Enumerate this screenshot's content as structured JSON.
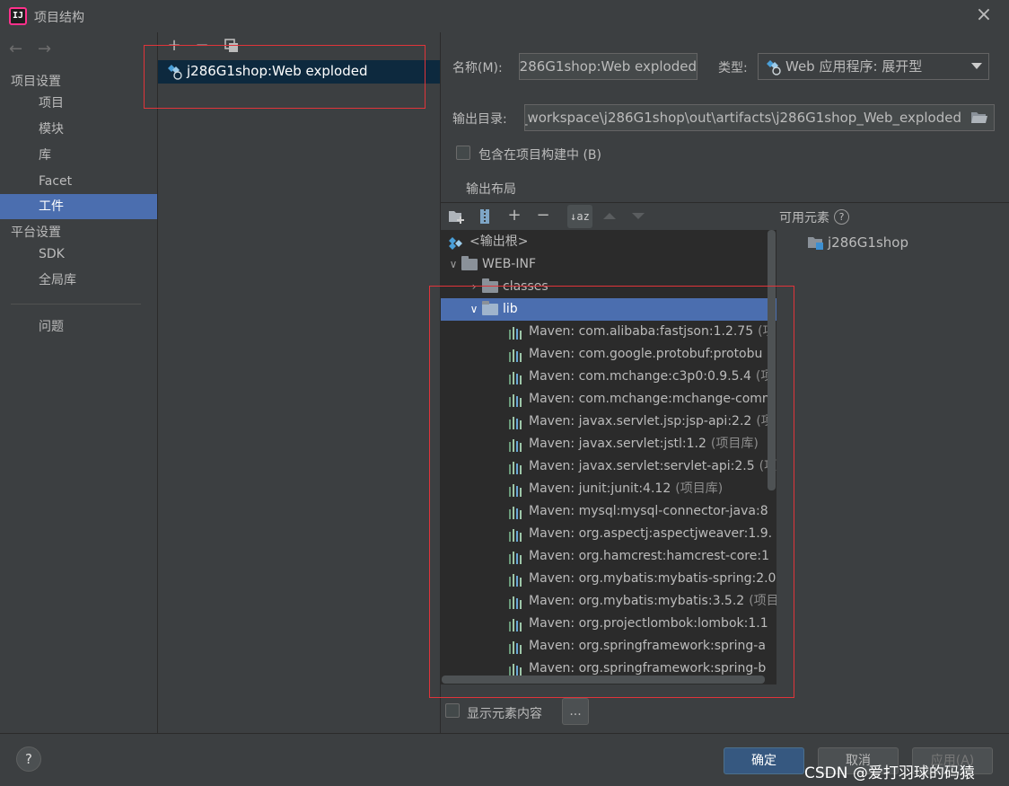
{
  "window": {
    "title": "项目结构",
    "app_icon_text": "IJ"
  },
  "left_nav": {
    "section_project": "项目设置",
    "project_items": [
      "项目",
      "模块",
      "库",
      "Facet",
      "工件"
    ],
    "section_platform": "平台设置",
    "platform_items": [
      "SDK",
      "全局库"
    ],
    "problems": "问题"
  },
  "middle": {
    "artifact_name": "j286G1shop:Web exploded"
  },
  "form": {
    "name_label": "名称(M):",
    "name_value": "j286G1shop:Web exploded",
    "type_label": "类型:",
    "type_value": "Web 应用程序: 展开型",
    "output_dir_label": "输出目录:",
    "output_dir_value": "_workspace\\j286G1shop\\out\\artifacts\\j286G1shop_Web_exploded",
    "include_label": "包含在项目构建中 (B)",
    "layout_tab": "输出布局",
    "available_label": "可用元素",
    "available_item": "j286G1shop"
  },
  "tree": {
    "root": "<输出根>",
    "webinf": "WEB-INF",
    "classes": "classes",
    "lib": "lib",
    "libs": [
      {
        "name": "Maven: com.alibaba:fastjson:1.2.75",
        "tail": "(项"
      },
      {
        "name": "Maven: com.google.protobuf:protobu",
        "tail": ""
      },
      {
        "name": "Maven: com.mchange:c3p0:0.9.5.4",
        "tail": "(项"
      },
      {
        "name": "Maven: com.mchange:mchange-comm",
        "tail": ""
      },
      {
        "name": "Maven: javax.servlet.jsp:jsp-api:2.2",
        "tail": "(项"
      },
      {
        "name": "Maven: javax.servlet:jstl:1.2",
        "tail": "(项目库)"
      },
      {
        "name": "Maven: javax.servlet:servlet-api:2.5",
        "tail": "(项"
      },
      {
        "name": "Maven: junit:junit:4.12",
        "tail": "(项目库)"
      },
      {
        "name": "Maven: mysql:mysql-connector-java:8",
        "tail": ""
      },
      {
        "name": "Maven: org.aspectj:aspectjweaver:1.9.",
        "tail": ""
      },
      {
        "name": "Maven: org.hamcrest:hamcrest-core:1",
        "tail": ""
      },
      {
        "name": "Maven: org.mybatis:mybatis-spring:2.0",
        "tail": ""
      },
      {
        "name": "Maven: org.mybatis:mybatis:3.5.2",
        "tail": "(项目"
      },
      {
        "name": "Maven: org.projectlombok:lombok:1.1",
        "tail": ""
      },
      {
        "name": "Maven: org.springframework:spring-a",
        "tail": ""
      },
      {
        "name": "Maven: org.springframework:spring-b",
        "tail": ""
      }
    ]
  },
  "footer": {
    "show_content_label": "显示元素内容",
    "ellipsis": "...",
    "ok": "确定",
    "cancel": "取消",
    "apply": "应用(A)",
    "help": "?",
    "watermark": "CSDN @爱打羽球的码猿"
  }
}
